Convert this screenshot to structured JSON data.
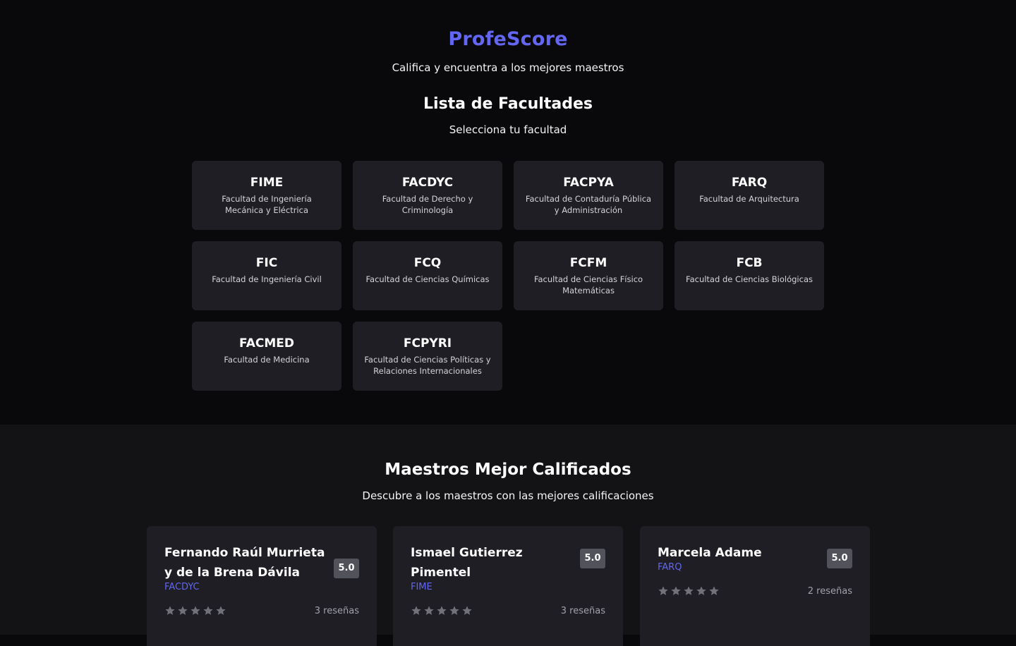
{
  "header": {
    "brand": "ProfeScore",
    "tagline": "Califica y encuentra a los mejores maestros"
  },
  "faculties_section": {
    "title": "Lista de Facultades",
    "subtitle": "Selecciona tu facultad",
    "items": [
      {
        "code": "FIME",
        "name": "Facultad de Ingeniería Mecánica y Eléctrica"
      },
      {
        "code": "FACDYC",
        "name": "Facultad de Derecho y Criminología"
      },
      {
        "code": "FACPYA",
        "name": "Facultad de Contaduría Pública y Administración"
      },
      {
        "code": "FARQ",
        "name": "Facultad de Arquitectura"
      },
      {
        "code": "FIC",
        "name": "Facultad de Ingeniería Civil"
      },
      {
        "code": "FCQ",
        "name": "Facultad de Ciencias Químicas"
      },
      {
        "code": "FCFM",
        "name": "Facultad de Ciencias Físico Matemáticas"
      },
      {
        "code": "FCB",
        "name": "Facultad de Ciencias Biológicas"
      },
      {
        "code": "FACMED",
        "name": "Facultad de Medicina"
      },
      {
        "code": "FCPYRI",
        "name": "Facultad de Ciencias Políticas y Relaciones Internacionales"
      }
    ]
  },
  "top_teachers": {
    "title": "Maestros Mejor Calificados",
    "subtitle": "Descubre a los maestros con las mejores calificaciones",
    "teachers": [
      {
        "name": "Fernando Raúl Murrieta y de la Brena Dávila",
        "faculty": "FACDYC",
        "score": "5.0",
        "reviews": "3 reseñas",
        "stars": 5
      },
      {
        "name": "Ismael Gutierrez Pimentel",
        "faculty": "FIME",
        "score": "5.0",
        "reviews": "3 reseñas",
        "stars": 5
      },
      {
        "name": "Marcela Adame",
        "faculty": "FARQ",
        "score": "5.0",
        "reviews": "2 reseñas",
        "stars": 5
      }
    ]
  },
  "colors": {
    "accent": "#6366f1",
    "star": "#71717a",
    "card": "#1e1e24"
  }
}
